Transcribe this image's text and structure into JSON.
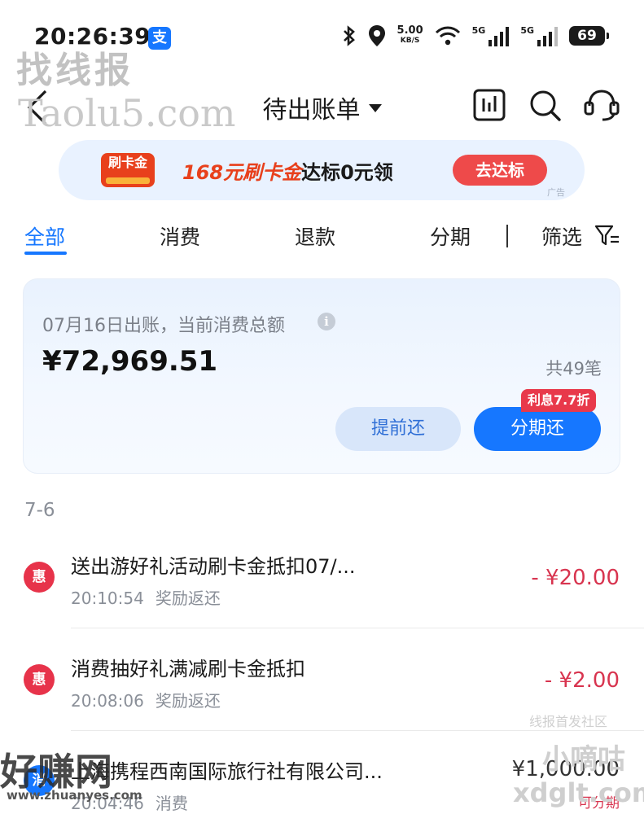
{
  "status_bar": {
    "time": "20:26:39",
    "app_badge": "支",
    "net_speed": "5.00",
    "net_unit": "KB/S",
    "sim1": "5G",
    "sim2": "5G",
    "battery": "69"
  },
  "watermarks": {
    "wm1": "找线报",
    "wm2": "Taolu5.com",
    "wm3": "线报首发社区",
    "wm4": "好赚网",
    "wm5": "www.zhuanyes.com",
    "wm6": "小嘀咕",
    "wm7": "xdglt.com"
  },
  "header": {
    "title": "待出账单"
  },
  "banner": {
    "badge": "刷卡金",
    "text_highlight": "168元刷卡金",
    "text_rest": "达标0元领",
    "button": "去达标",
    "ad_label": "广告"
  },
  "tabs": [
    {
      "label": "全部",
      "active": true
    },
    {
      "label": "消费",
      "active": false
    },
    {
      "label": "退款",
      "active": false
    },
    {
      "label": "分期",
      "active": false
    }
  ],
  "filter": {
    "label": "筛选"
  },
  "summary": {
    "date_text": "07月16日出账，当前消费总额",
    "info_glyph": "i",
    "amount": "¥72,969.51",
    "count": "共49笔",
    "early_repay": "提前还",
    "installment": "分期还",
    "promo": "利息7.7折"
  },
  "transactions": {
    "date_group": "7-6",
    "items": [
      {
        "icon_text": "惠",
        "title": "送出游好礼活动刷卡金抵扣07/...",
        "time": "20:10:54",
        "type": "奖励返还",
        "amount": "- ¥20.00"
      },
      {
        "icon_text": "惠",
        "title": "消费抽好礼满减刷卡金抵扣",
        "time": "20:08:06",
        "type": "奖励返还",
        "amount": "- ¥2.00"
      },
      {
        "icon_text": "消",
        "title": "上海携程西南国际旅行社有限公司...",
        "time": "20:04:46",
        "type": "消费",
        "amount": "¥1,000.00",
        "sub": "可分期"
      }
    ]
  },
  "colors": {
    "accent": "#1677ff",
    "negative": "#d8344f",
    "promo": "#e8394b"
  }
}
